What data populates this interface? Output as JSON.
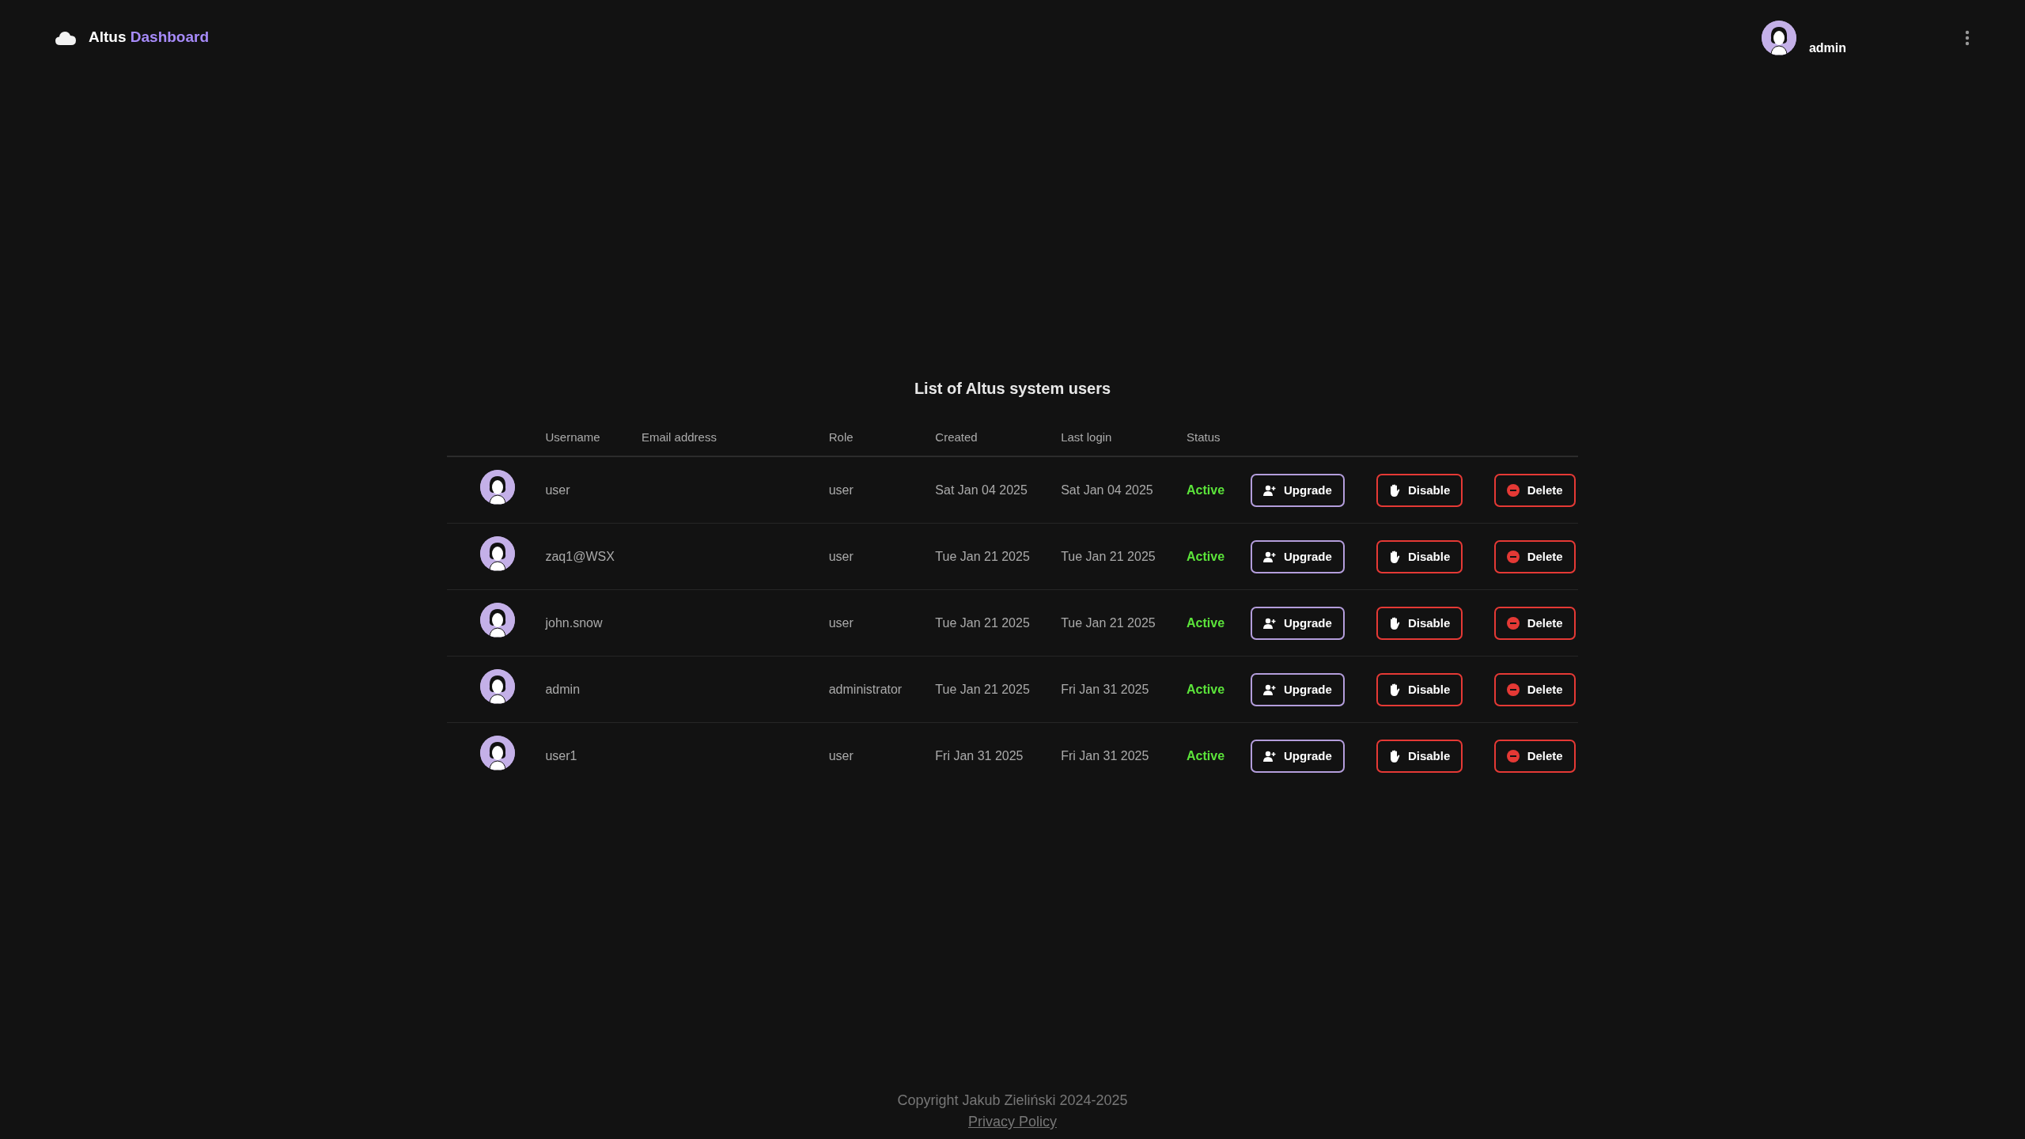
{
  "header": {
    "brand": "Altus",
    "brand_accent": "Dashboard",
    "user": "admin"
  },
  "title": "List of Altus system users",
  "columns": [
    "Username",
    "Email address",
    "Role",
    "Created",
    "Last login",
    "Status"
  ],
  "rows": [
    {
      "username": "user",
      "email": "",
      "role": "user",
      "created": "Sat Jan 04 2025",
      "last_login": "Sat Jan 04 2025",
      "status": "Active",
      "actions": [
        "Upgrade",
        "Disable",
        "Delete"
      ]
    },
    {
      "username": "zaq1@WSX",
      "email": "",
      "role": "user",
      "created": "Tue Jan 21 2025",
      "last_login": "Tue Jan 21 2025",
      "status": "Active",
      "actions": [
        "Upgrade",
        "Disable",
        "Delete"
      ]
    },
    {
      "username": "john.snow",
      "email": "",
      "role": "user",
      "created": "Tue Jan 21 2025",
      "last_login": "Tue Jan 21 2025",
      "status": "Active",
      "actions": [
        "Upgrade",
        "Disable",
        "Delete"
      ]
    },
    {
      "username": "admin",
      "email": "",
      "role": "administrator",
      "created": "Tue Jan 21 2025",
      "last_login": "Fri Jan 31 2025",
      "status": "Active",
      "actions": [
        "Upgrade",
        "Disable",
        "Delete"
      ]
    },
    {
      "username": "user1",
      "email": "",
      "role": "user",
      "created": "Fri Jan 31 2025",
      "last_login": "Fri Jan 31 2025",
      "status": "Active",
      "actions": [
        "Upgrade",
        "Disable",
        "Delete"
      ]
    }
  ],
  "footer": {
    "copyright": "Copyright Jakub Zieliński 2024-2025",
    "link": "Privacy Policy"
  }
}
